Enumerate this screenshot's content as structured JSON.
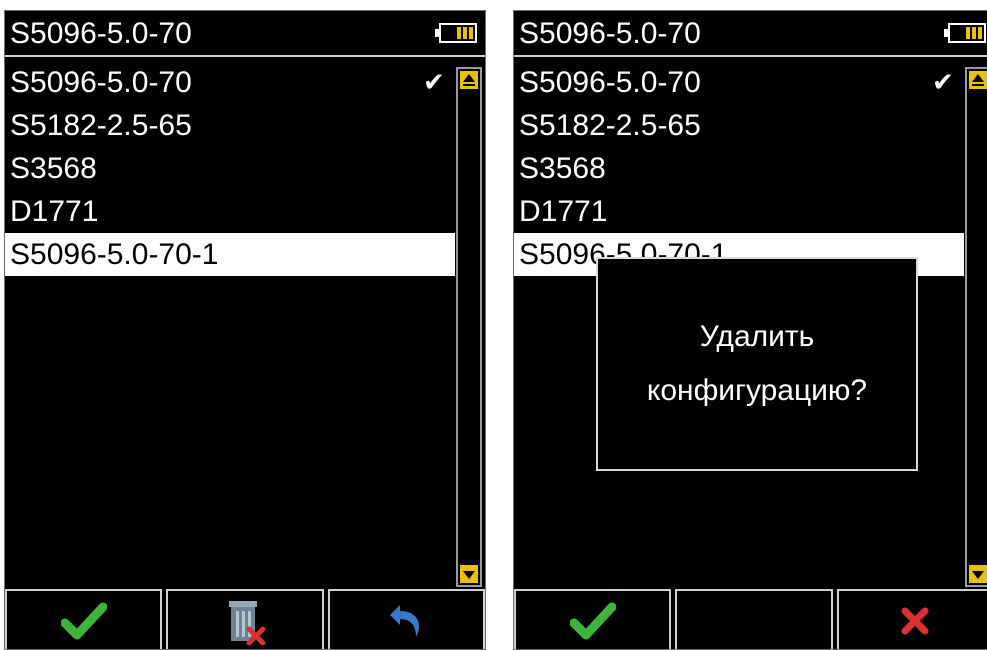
{
  "colors": {
    "background": "#000000",
    "text": "#ffffff",
    "accent": "#e6c200",
    "ok_green": "#3db53d",
    "cancel_red": "#d93030",
    "back_blue": "#3a78c8"
  },
  "left_screen": {
    "title": "S5096-5.0-70",
    "items": [
      {
        "label": "S5096-5.0-70",
        "checked": true
      },
      {
        "label": "S5182-2.5-65"
      },
      {
        "label": "S3568"
      },
      {
        "label": "D1771"
      },
      {
        "label": "S5096-5.0-70-1",
        "selected": true
      }
    ],
    "check_symbol": "✔",
    "softkeys": [
      {
        "icon": "checkmark-icon"
      },
      {
        "icon": "trash-delete-icon"
      },
      {
        "icon": "back-arrow-icon"
      }
    ]
  },
  "right_screen": {
    "title": "S5096-5.0-70",
    "items": [
      {
        "label": "S5096-5.0-70",
        "checked": true
      },
      {
        "label": "S5182-2.5-65"
      },
      {
        "label": "S3568"
      },
      {
        "label": "D1771"
      },
      {
        "label": "S5096-5.0-70-1",
        "selected": true
      }
    ],
    "check_symbol": "✔",
    "dialog": {
      "line1": "Удалить",
      "line2": "конфигурацию?"
    },
    "softkeys": [
      {
        "icon": "checkmark-icon"
      },
      {
        "icon": "empty"
      },
      {
        "icon": "cancel-x-icon"
      }
    ]
  }
}
